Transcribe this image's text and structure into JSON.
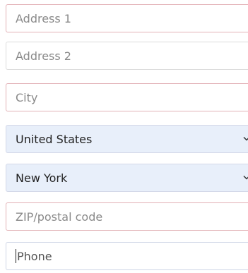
{
  "form": {
    "address1": {
      "placeholder": "Address 1"
    },
    "address2": {
      "placeholder": "Address 2"
    },
    "city": {
      "placeholder": "City"
    },
    "country": {
      "value": "United States"
    },
    "state": {
      "value": "New York"
    },
    "zip": {
      "placeholder": "ZIP/postal code"
    },
    "phone": {
      "placeholder": "Phone"
    }
  },
  "colors": {
    "invalid_border": "#e2b1b6",
    "select_background": "#e8effa",
    "placeholder_text": "#8a8a8a"
  },
  "icons": {
    "select_chevron": "chevron-down-icon"
  }
}
